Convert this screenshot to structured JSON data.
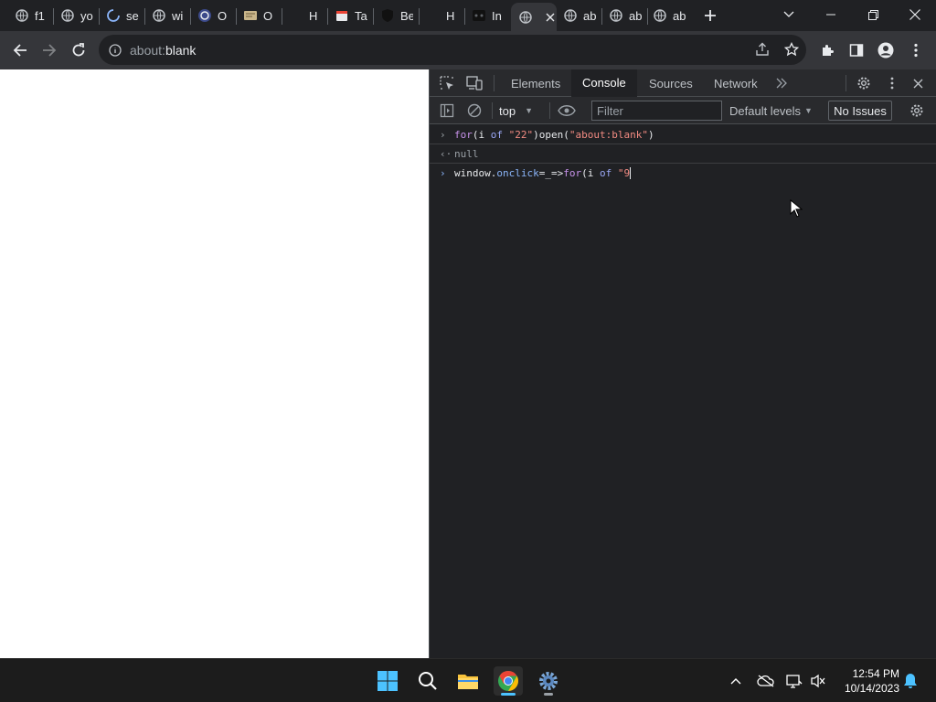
{
  "tabs": [
    {
      "title": "f1"
    },
    {
      "title": "yo"
    },
    {
      "title": "se"
    },
    {
      "title": "wi"
    },
    {
      "title": "O"
    },
    {
      "title": "O"
    },
    {
      "title": "H"
    },
    {
      "title": "Ta"
    },
    {
      "title": "Be"
    },
    {
      "title": "H"
    },
    {
      "title": "In"
    },
    {
      "title": ""
    },
    {
      "title": "ab"
    },
    {
      "title": "ab"
    },
    {
      "title": "ab"
    }
  ],
  "omnibox": {
    "scheme": "about:",
    "host": "blank"
  },
  "devtools": {
    "tabs": {
      "elements": "Elements",
      "console": "Console",
      "sources": "Sources",
      "network": "Network"
    },
    "context": "top",
    "filter_placeholder": "Filter",
    "levels": "Default levels",
    "issues": "No Issues",
    "console": {
      "line1": {
        "kw_for": "for",
        "open": "(i ",
        "kw_of": "of",
        "sp": " ",
        "str1": "\"22\"",
        "mid": ")open(",
        "str2": "\"about:blank\"",
        "close": ")"
      },
      "result": "null",
      "line2": {
        "obj": "window.",
        "prop": "onclick",
        "mid": "=_=>",
        "kw_for": "for",
        "open": "(i ",
        "kw_of": "of",
        "sp": " ",
        "str": "\"9"
      }
    }
  },
  "taskbar": {
    "time": "12:54 PM",
    "date": "10/14/2023"
  },
  "colors": {
    "accent": "#4cc2ff",
    "chrome_bg": "#202124",
    "toolbar_bg": "#35363a"
  }
}
